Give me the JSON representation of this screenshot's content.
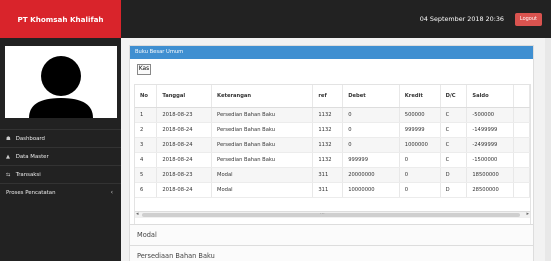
{
  "header": {
    "brand": "PT Khomsah Khalifah",
    "datetime": "04 September 2018 20:36",
    "logout_label": "Logout"
  },
  "sidebar": {
    "items": [
      {
        "icon": "dashboard-icon",
        "glyph": "☗",
        "label": "Dashboard"
      },
      {
        "icon": "user-icon",
        "glyph": "▲",
        "label": "Data Master"
      },
      {
        "icon": "exchange-icon",
        "glyph": "⇆",
        "label": "Transaksi"
      },
      {
        "icon": "",
        "glyph": "",
        "label": "Proses Pencatatan",
        "chevron": "‹"
      }
    ]
  },
  "main": {
    "panel_title": "Buku Besar Umum",
    "tab_label": "Kas",
    "table": {
      "columns": [
        "No",
        "Tanggal",
        "Keterangan",
        "ref",
        "Debet",
        "Kredit",
        "D/C",
        "Saldo"
      ],
      "rows": [
        [
          "1",
          "2018-08-23",
          "Persedian Bahan Baku",
          "1132",
          "0",
          "500000",
          "C",
          "-500000"
        ],
        [
          "2",
          "2018-08-24",
          "Persedian Bahan Baku",
          "1132",
          "0",
          "999999",
          "C",
          "-1499999"
        ],
        [
          "3",
          "2018-08-24",
          "Persedian Bahan Baku",
          "1132",
          "0",
          "1000000",
          "C",
          "-2499999"
        ],
        [
          "4",
          "2018-08-24",
          "Persedian Bahan Baku",
          "1132",
          "999999",
          "0",
          "C",
          "-1500000"
        ],
        [
          "5",
          "2018-08-23",
          "Modal",
          "311",
          "20000000",
          "0",
          "D",
          "18500000"
        ],
        [
          "6",
          "2018-08-24",
          "Modal",
          "311",
          "10000000",
          "0",
          "D",
          "28500000"
        ]
      ]
    },
    "sections": [
      "Modal",
      "Persediaan Bahan Baku"
    ]
  },
  "colors": {
    "brand_red": "#d9242b",
    "topbar": "#222222",
    "panel_head_blue": "#3f8fd1",
    "logout_red": "#d9534f"
  }
}
